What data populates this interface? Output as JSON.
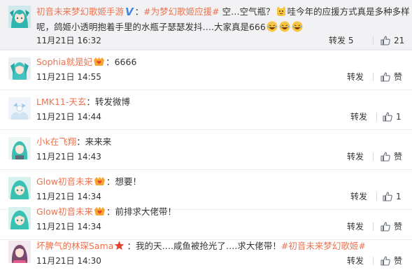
{
  "post": {
    "author": "初音未来梦幻歌姬手游",
    "topic": "#为梦幻歌姬应援#",
    "text_a": " 空…空气瓶？",
    "text_b": "哇今年的应援方式真是多种多样",
    "line2": "呢，鸽姬小透明抱着手里的水瓶子瑟瑟发抖….大家真是666",
    "time": "11月21日 16:32",
    "repost_label": "转发",
    "repost_count": "5",
    "like_count": "21",
    "accent_color": "#eb7350"
  },
  "comments": [
    {
      "user": "Sophia就是妃",
      "text": "6666",
      "time": "11月21日 14:55",
      "repost_label": "转发",
      "like_label": "赞",
      "badge": "fan-badge-icon"
    },
    {
      "user": "LMK11-天玄",
      "text": "转发微博",
      "time": "11月21日 14:44",
      "repost_label": "转发",
      "like_label": "1",
      "badge": ""
    },
    {
      "user": "小k在飞翔",
      "text": "来来来",
      "time": "11月21日 14:43",
      "repost_label": "转发",
      "like_label": "赞",
      "badge": ""
    },
    {
      "user": "Glow初音未来",
      "text": "想要！",
      "time": "11月21日 14:34",
      "repost_label": "转发",
      "like_label": "1",
      "badge": "fan-badge-icon"
    },
    {
      "user": "Glow初音未来",
      "text": "前排求大佬带！",
      "time": "11月21日 14:34",
      "repost_label": "转发",
      "like_label": "赞",
      "badge": "fan-badge-icon"
    },
    {
      "user": "坏脾气的林琛Sama",
      "text_a": "我的天….咸鱼被抢光了….求大佬带！",
      "topic": "#初音未来梦幻歌姬#",
      "time": "11月21日 14:30",
      "repost_label": "转发",
      "like_label": "赞",
      "badge": "star-badge-icon"
    }
  ]
}
